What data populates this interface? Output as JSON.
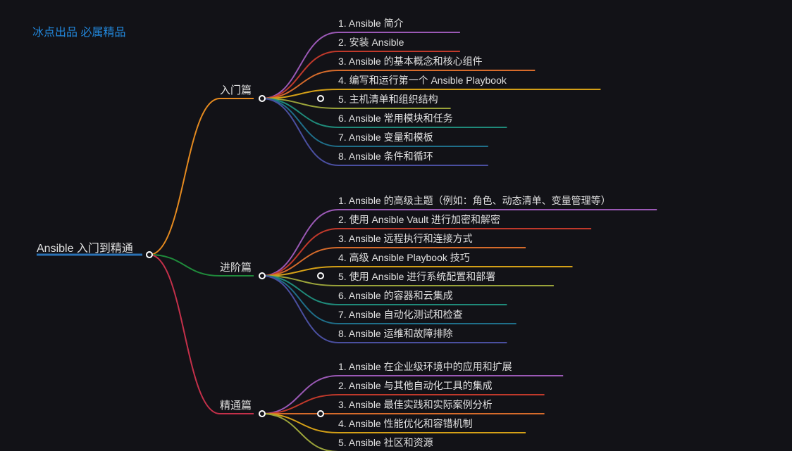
{
  "watermark": "冰点出品 必属精品",
  "root": {
    "label": "Ansible 入门到精通"
  },
  "sections": [
    {
      "key": "intro",
      "label": "入门篇",
      "items": [
        "1. Ansible 简介",
        "2. 安装 Ansible",
        "3. Ansible 的基本概念和核心组件",
        "4. 编写和运行第一个 Ansible Playbook",
        "5. 主机清单和组织结构",
        "6. Ansible 常用模块和任务",
        "7. Ansible 变量和模板",
        "8. Ansible 条件和循环"
      ]
    },
    {
      "key": "advanced",
      "label": "进阶篇",
      "items": [
        "1. Ansible 的高级主题（例如：角色、动态清单、变量管理等）",
        "2. 使用 Ansible Vault 进行加密和解密",
        "3. Ansible 远程执行和连接方式",
        "4. 高级 Ansible Playbook 技巧",
        "5. 使用 Ansible 进行系统配置和部署",
        "6. Ansible 的容器和云集成",
        "7. Ansible 自动化测试和检查",
        "8. Ansible 运维和故障排除"
      ]
    },
    {
      "key": "master",
      "label": "精通篇",
      "items": [
        "1. Ansible 在企业级环境中的应用和扩展",
        "2. Ansible 与其他自动化工具的集成",
        "3. Ansible 最佳实践和实际案例分析",
        "4. Ansible 性能优化和容错机制",
        "5. Ansible 社区和资源"
      ]
    }
  ],
  "colors": {
    "root_underline": "#2a72b5",
    "section_intro": "#e58a1f",
    "section_advanced": "#1f8a3b",
    "section_master": "#c4304a",
    "leaf_palette": [
      "#9b59b6",
      "#c0392b",
      "#d66b2b",
      "#d4a017",
      "#9aa33a",
      "#1f8a7a",
      "#1f6f8a",
      "#4a4fa0"
    ]
  }
}
